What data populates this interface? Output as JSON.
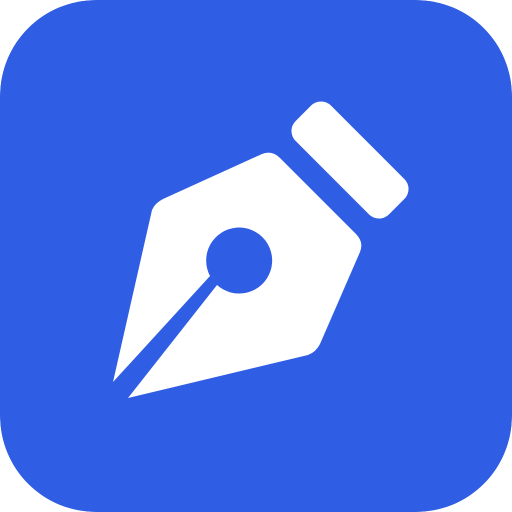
{
  "icon": {
    "name": "fountain-pen-nib-icon",
    "colors": {
      "background": "#2F5DE3",
      "glyph": "#FFFFFF"
    }
  }
}
